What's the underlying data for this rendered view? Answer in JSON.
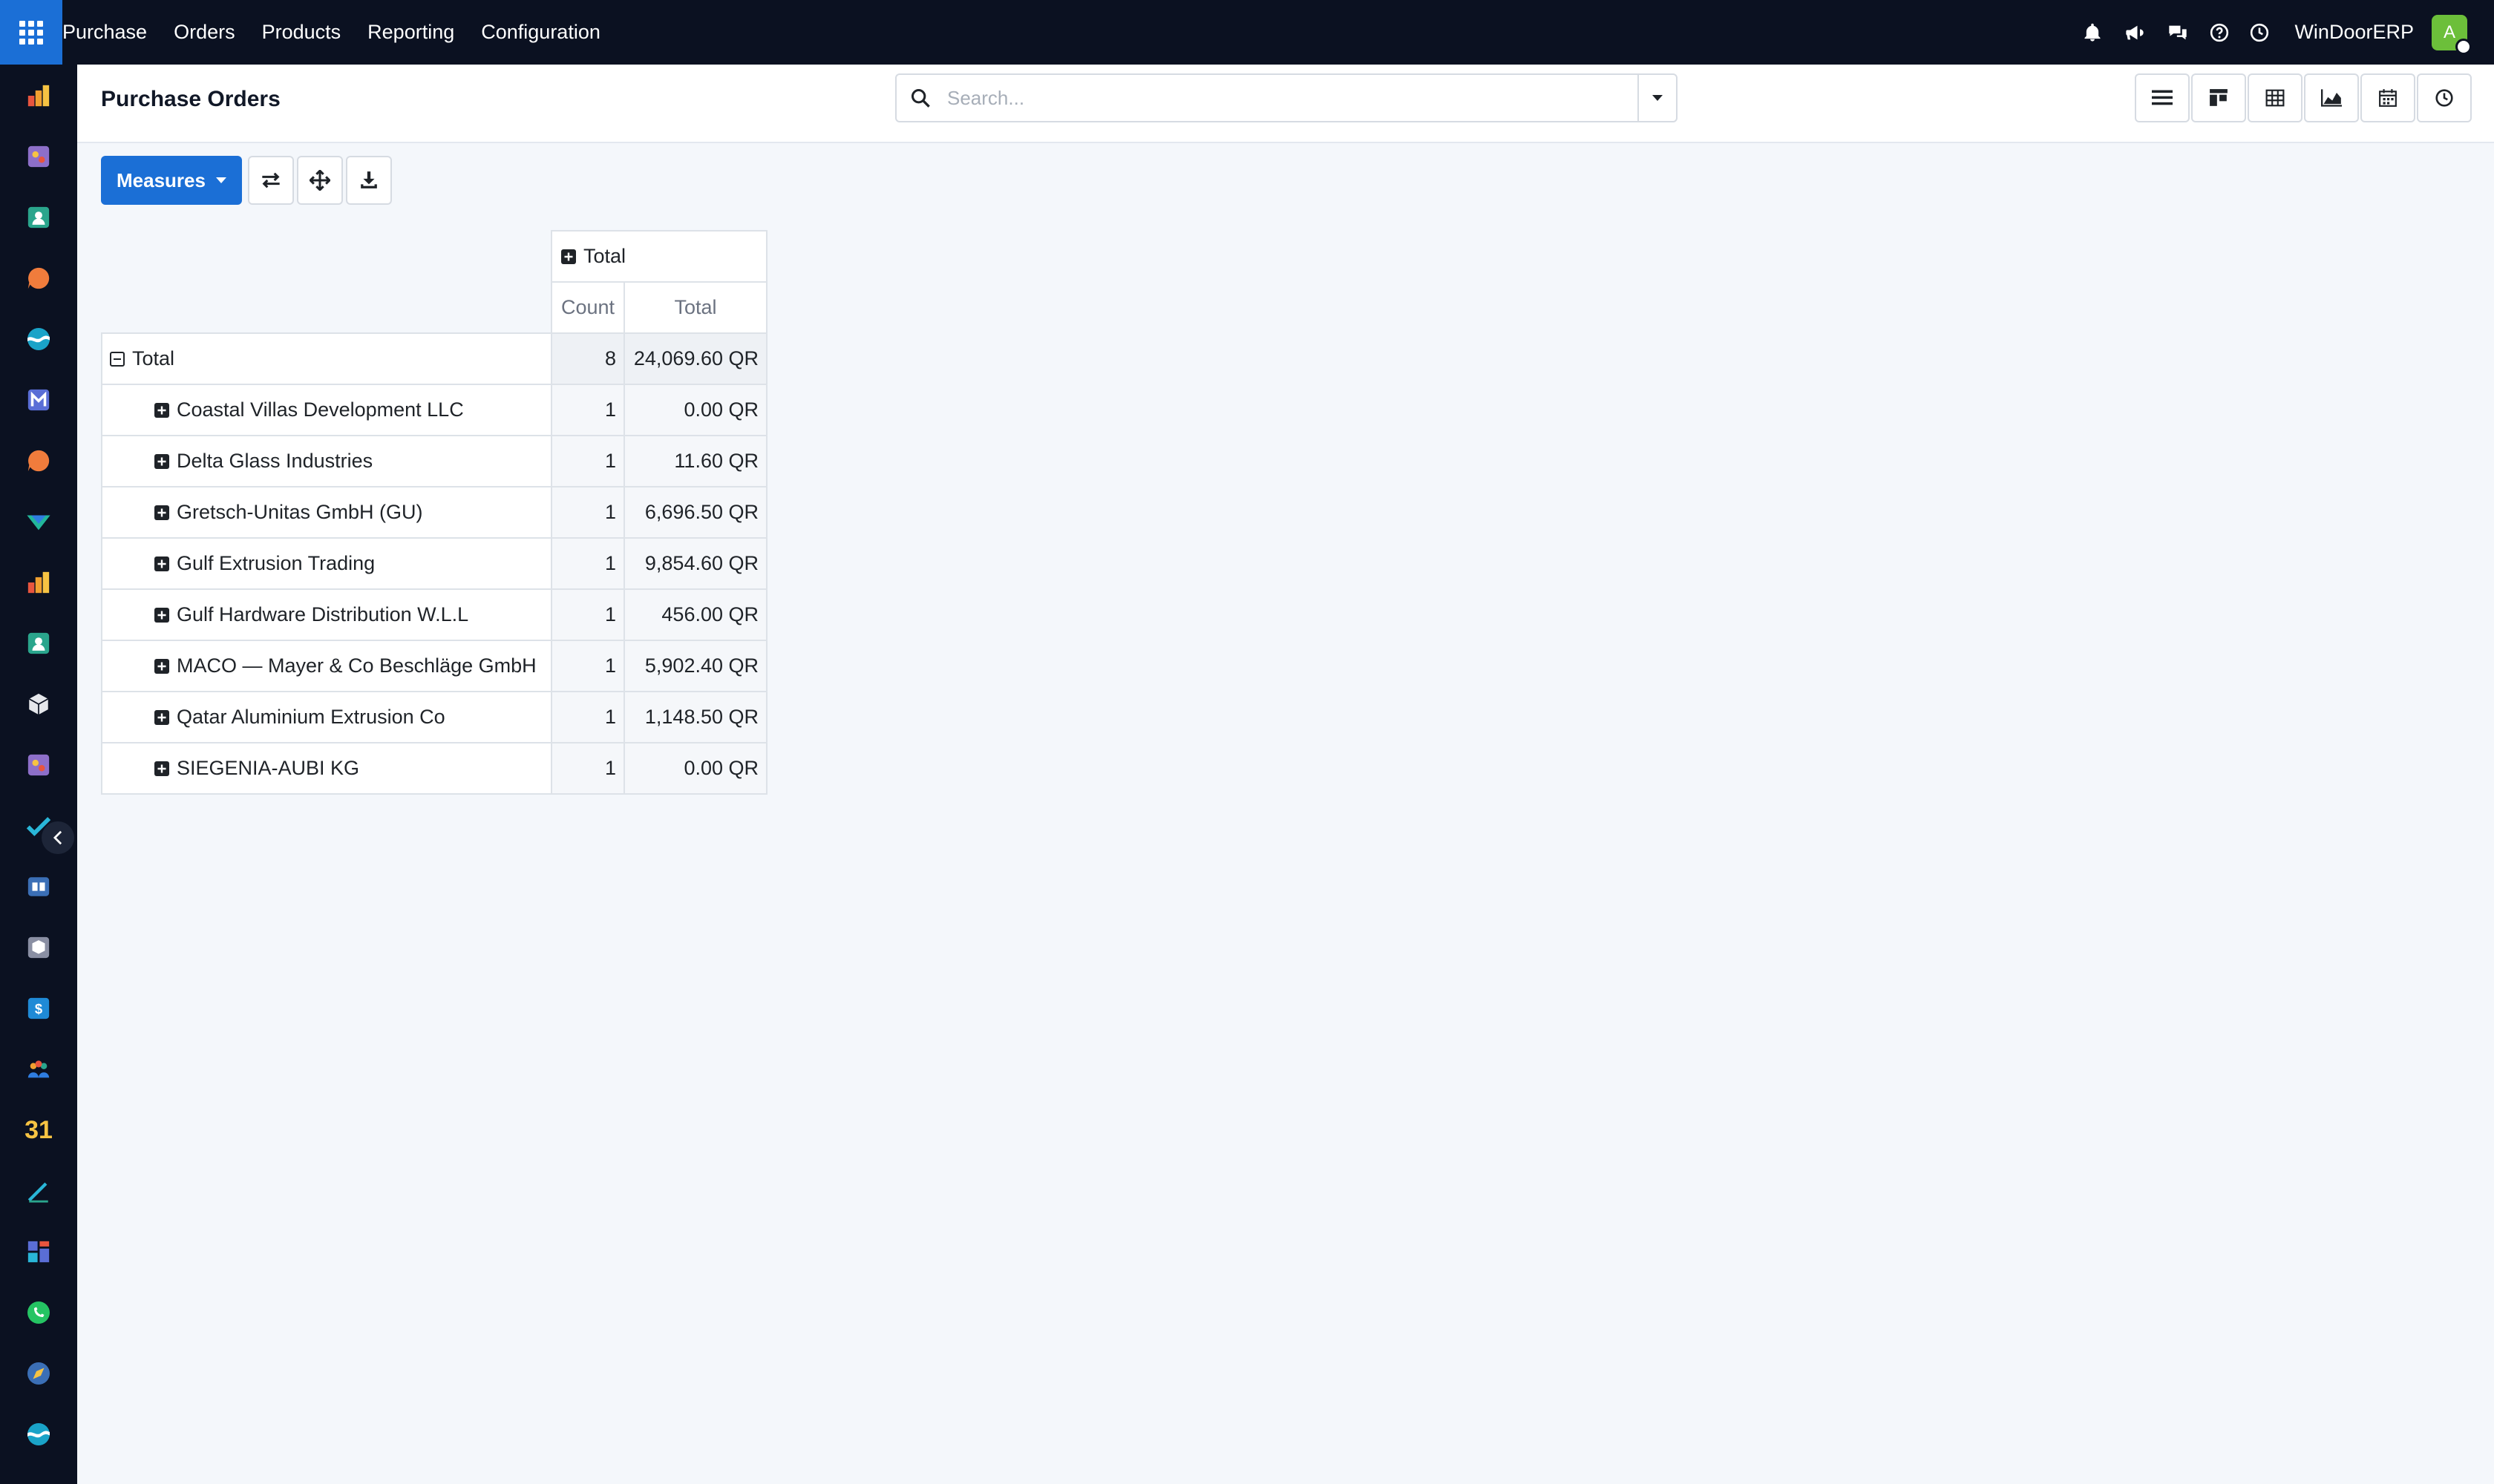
{
  "topbar": {
    "menu": [
      "Purchase",
      "Orders",
      "Products",
      "Reporting",
      "Configuration"
    ],
    "company": "WinDoorERP",
    "avatar_initial": "A",
    "icons": [
      "bell-icon",
      "megaphone-icon",
      "chat-icon",
      "help-icon",
      "clock-icon"
    ]
  },
  "sidebar": {
    "icons": [
      "chart-app-icon",
      "palette-app-icon",
      "contacts-app-icon",
      "chat-bubble-app-icon",
      "wave-app-icon",
      "mail-app-icon",
      "chat-bubble-app-icon",
      "arrow-app-icon",
      "chart-app-icon",
      "contacts-app-icon",
      "box-app-icon",
      "palette-app-icon",
      "check-app-icon",
      "book-app-icon",
      "cube-app-icon",
      "dollar-app-icon",
      "team-app-icon",
      "calendar-app-icon",
      "pen-app-icon",
      "dashboard-app-icon",
      "whatsapp-app-icon",
      "compass-app-icon",
      "wave-app-icon"
    ],
    "calendar_day": "31"
  },
  "control_panel": {
    "title": "Purchase Orders",
    "search_placeholder": "Search..."
  },
  "toolbar": {
    "measures_label": "Measures"
  },
  "pivot": {
    "column_group": "Total",
    "measures": [
      "Count",
      "Total"
    ],
    "total_row": {
      "label": "Total",
      "count": "8",
      "total": "24,069.60 QR"
    },
    "rows": [
      {
        "label": "Coastal Villas Development LLC",
        "count": "1",
        "total": "0.00 QR"
      },
      {
        "label": "Delta Glass Industries",
        "count": "1",
        "total": "11.60 QR"
      },
      {
        "label": "Gretsch-Unitas GmbH (GU)",
        "count": "1",
        "total": "6,696.50 QR"
      },
      {
        "label": "Gulf Extrusion Trading",
        "count": "1",
        "total": "9,854.60 QR"
      },
      {
        "label": "Gulf Hardware Distribution W.L.L",
        "count": "1",
        "total": "456.00 QR"
      },
      {
        "label": "MACO — Mayer & Co Beschläge GmbH",
        "count": "1",
        "total": "5,902.40 QR"
      },
      {
        "label": "Qatar Aluminium Extrusion Co",
        "count": "1",
        "total": "1,148.50 QR"
      },
      {
        "label": "SIEGENIA-AUBI KG",
        "count": "1",
        "total": "0.00 QR"
      }
    ]
  },
  "colors": {
    "navbar": "#0b1121",
    "accent": "#1b6fd6",
    "background": "#f4f7fb"
  }
}
